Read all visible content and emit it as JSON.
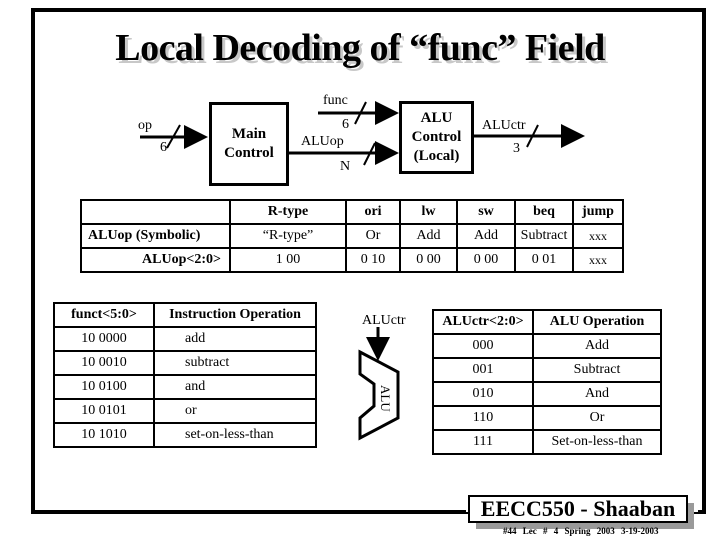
{
  "title": "Local Decoding of “func” Field",
  "diagram": {
    "op_label": "op",
    "op_width": "6",
    "main_control": [
      "Main",
      "Control"
    ],
    "func_label": "func",
    "func_width": "6",
    "aluop_label": "ALUop",
    "aluop_width": "N",
    "alu_control": [
      "ALU",
      "Control",
      "(Local)"
    ],
    "aluctr_label": "ALUctr",
    "aluctr_width": "3"
  },
  "aluop_table": {
    "headers": [
      "",
      "R-type",
      "ori",
      "lw",
      "sw",
      "beq",
      "jump"
    ],
    "rows": [
      {
        "label": "ALUop (Symbolic)",
        "values": [
          "“R-type”",
          "Or",
          "Add",
          "Add",
          "Subtract",
          "xxx"
        ]
      },
      {
        "label": "ALUop<2:0>",
        "values": [
          "1 00",
          "0 10",
          "0 00",
          "0 00",
          "0 01",
          "xxx"
        ]
      }
    ]
  },
  "funct_table": {
    "headers": [
      "funct<5:0>",
      "Instruction Operation"
    ],
    "rows": [
      [
        "10 0000",
        "add"
      ],
      [
        "10 0010",
        "subtract"
      ],
      [
        "10 0100",
        "and"
      ],
      [
        "10 0101",
        "or"
      ],
      [
        "10 1010",
        "set-on-less-than"
      ]
    ]
  },
  "alu_symbol": {
    "input_label": "ALUctr",
    "body_label": "ALU"
  },
  "aluctr_table": {
    "headers": [
      "ALUctr<2:0>",
      "ALU Operation"
    ],
    "rows": [
      [
        "000",
        "Add"
      ],
      [
        "001",
        "Subtract"
      ],
      [
        "010",
        "And"
      ],
      [
        "110",
        "Or"
      ],
      [
        "111",
        "Set-on-less-than"
      ]
    ]
  },
  "footer": {
    "title": "EECC550 - Shaaban",
    "subtitle": "#44  Lec # 4  Spring 2003   3-19-2003"
  }
}
